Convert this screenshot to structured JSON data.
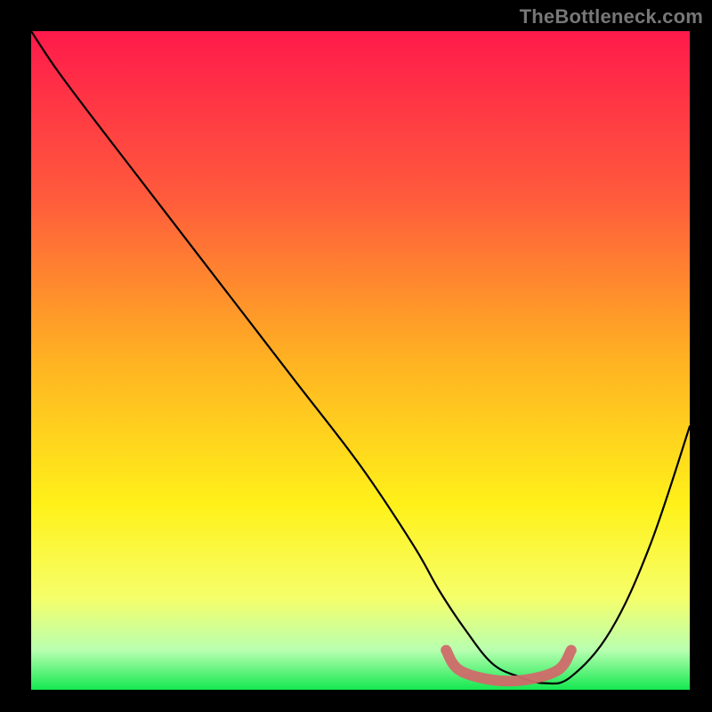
{
  "attribution": "TheBottleneck.com",
  "chart_data": {
    "type": "line",
    "title": "",
    "xlabel": "",
    "ylabel": "",
    "xlim": [
      0,
      100
    ],
    "ylim": [
      0,
      100
    ],
    "gradient_stops": [
      {
        "offset": 0,
        "color": "#ff1a4b"
      },
      {
        "offset": 25,
        "color": "#ff5a3c"
      },
      {
        "offset": 50,
        "color": "#ffb222"
      },
      {
        "offset": 72,
        "color": "#fff11a"
      },
      {
        "offset": 86,
        "color": "#f6ff6a"
      },
      {
        "offset": 94,
        "color": "#b8ffb0"
      },
      {
        "offset": 100,
        "color": "#14e850"
      }
    ],
    "series": [
      {
        "name": "bottleneck-curve",
        "type": "line",
        "color": "#000000",
        "x": [
          0,
          4,
          10,
          20,
          30,
          40,
          50,
          58,
          62,
          66,
          70,
          74,
          78,
          82,
          88,
          94,
          100
        ],
        "y": [
          100,
          94,
          86,
          73,
          60,
          47,
          34,
          22,
          15,
          9,
          4,
          2,
          1,
          2,
          9,
          22,
          40
        ]
      },
      {
        "name": "optimal-range-marker",
        "type": "line",
        "color": "#d06a6a",
        "x": [
          63,
          65,
          70,
          75,
          80,
          82
        ],
        "y": [
          6,
          3,
          1.5,
          1.5,
          3,
          6
        ]
      }
    ]
  }
}
